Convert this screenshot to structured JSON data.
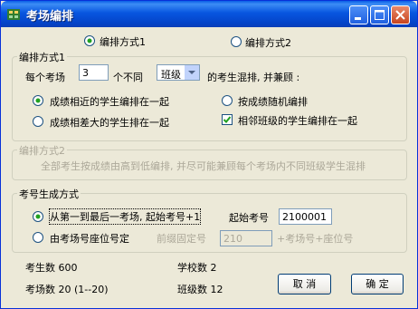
{
  "window": {
    "title": "考场编排",
    "icon": "app-tree-icon"
  },
  "titlebar_buttons": [
    "minimize-icon",
    "maximize-icon",
    "close-icon"
  ],
  "mode": {
    "option1": "编排方式1",
    "option2": "编排方式2",
    "selected": "option1"
  },
  "mode1": {
    "legend": "编排方式1",
    "per_room_prefix": "每个考场",
    "per_room_value": "3",
    "per_room_middle": "个不同",
    "group_select": "班级",
    "suffix": "的考生混排, 并兼顾 :",
    "opt_similar": "成绩相近的学生编排在一起",
    "opt_random": "按成绩随机编排",
    "opt_diverse": "成绩相差大的学生排在一起",
    "opt_adjacent_class": "相邻班级的学生编排在一起",
    "selected": "opt_similar",
    "adjacent_checked": true
  },
  "mode2": {
    "legend": "编排方式2",
    "description": "全部考生按成绩由高到低编排, 并尽可能兼顾每个考场内不同班级学生混排"
  },
  "number_gen": {
    "legend": "考号生成方式",
    "opt_sequential": "从第一到最后一考场, 起始考号+1",
    "start_label": "起始考号",
    "start_value": "2100001",
    "opt_by_seat": "由考场号座位号定",
    "prefix_label": "前缀固定号",
    "prefix_value": "210",
    "prefix_suffix": "+考场号+座位号",
    "selected": "opt_sequential"
  },
  "stats": {
    "students": "考生数 600",
    "schools": "学校数 2",
    "rooms": "考场数 20 (1--20)",
    "classes": "班级数 12"
  },
  "buttons": {
    "cancel": "取 消",
    "ok": "确 定"
  }
}
